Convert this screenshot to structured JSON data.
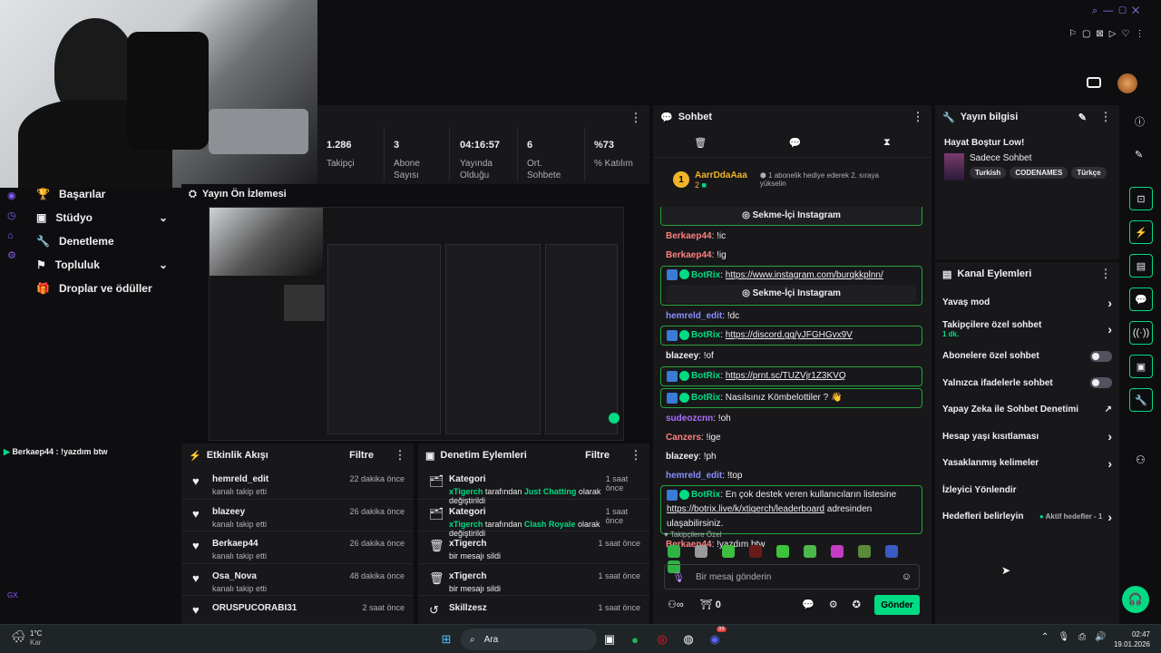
{
  "stats": [
    {
      "value": "1.286",
      "label": "Takipçi"
    },
    {
      "value": "3",
      "label": "Abone Sayısı"
    },
    {
      "value": "04:16:57",
      "label": "Yayında Olduğu"
    },
    {
      "value": "6",
      "label": "Ort. Sohbete"
    },
    {
      "value": "%73",
      "label": "% Katılım"
    }
  ],
  "nav": {
    "items": [
      {
        "label": "Başarılar",
        "chevron": false
      },
      {
        "label": "Stüdyo",
        "chevron": true
      },
      {
        "label": "Denetleme",
        "chevron": false
      },
      {
        "label": "Topluluk",
        "chevron": true
      },
      {
        "label": "Droplar ve ödüller",
        "chevron": false
      }
    ]
  },
  "preview": {
    "title": "Yayın Ön İzlemesi"
  },
  "side_chat_line": "Berkaep44 : !yazdım btw",
  "side_gx": "GX",
  "activity": {
    "title": "Etkinlik Akışı",
    "filter": "Filtre",
    "rows": [
      {
        "name": "hemreld_edit",
        "sub": "kanalı takip etti",
        "time": "22 dakika önce"
      },
      {
        "name": "blazeey",
        "sub": "kanalı takip etti",
        "time": "26 dakika önce"
      },
      {
        "name": "Berkaep44",
        "sub": "kanalı takip etti",
        "time": "26 dakika önce"
      },
      {
        "name": "Osa_Nova",
        "sub": "kanalı takip etti",
        "time": "48 dakika önce"
      },
      {
        "name": "ORUSPUCORABI31",
        "sub": "",
        "time": "2 saat önce"
      }
    ]
  },
  "moderation": {
    "title": "Denetim Eylemleri",
    "filter": "Filtre",
    "rows": [
      {
        "title": "Kategori",
        "actor": "xTigerch",
        "mid": " tarafından ",
        "target": "Just Chatting",
        "end": " olarak değiştirildi",
        "time": "1 saat önce"
      },
      {
        "title": "Kategori",
        "actor": "xTigerch",
        "mid": " tarafından ",
        "target": "Clash Royale",
        "end": " olarak değiştirildi",
        "time": "1 saat önce"
      },
      {
        "title": "xTigerch",
        "actor": "",
        "mid": "bir mesajı sildi",
        "target": "",
        "end": "",
        "time": "1 saat önce"
      },
      {
        "title": "xTigerch",
        "actor": "",
        "mid": "bir mesajı sildi",
        "target": "",
        "end": "",
        "time": "1 saat önce"
      },
      {
        "title": "Skillzesz",
        "actor": "",
        "mid": "",
        "target": "",
        "end": "",
        "time": "1 saat önce"
      }
    ]
  },
  "chat": {
    "title": "Sohbet",
    "gift_user": "AarrDdaAaa",
    "gift_count": "2",
    "gift_rank": "1",
    "gift_text": "1 abonelik hediye ederek 2. sıraya yükselin",
    "instagram_label": "Sekme-İçi Instagram",
    "messages": [
      {
        "user": "Berkaep44",
        "text": "!ic",
        "bot": false,
        "color": "#ff7f7f"
      },
      {
        "user": "Berkaep44",
        "text": "!ig",
        "bot": false,
        "color": "#ff7f7f"
      },
      {
        "user": "BotRix",
        "text": "https://www.instagram.com/burqkkplnn/",
        "bot": true,
        "link": true,
        "ig": true
      },
      {
        "user": "hemreld_edit",
        "text": "!dc",
        "bot": false,
        "color": "#8a8cff"
      },
      {
        "user": "BotRix",
        "text": "https://discord.gg/yJFGHGvx9V",
        "bot": true,
        "link": true
      },
      {
        "user": "blazeey",
        "text": "!of",
        "bot": false,
        "color": "#efeff1"
      },
      {
        "user": "BotRix",
        "text": "https://prnt.sc/TUZVjr1Z3KVQ",
        "bot": true,
        "link": true
      },
      {
        "user": "BotRix",
        "text": "Nasılsınız Kömbelottiler ? 👋",
        "bot": true,
        "link": false
      },
      {
        "user": "sudeozcnn",
        "text": "!oh",
        "bot": false,
        "color": "#a970ff"
      },
      {
        "user": "Canzers",
        "text": "!ige",
        "bot": false,
        "color": "#ff7f7f"
      },
      {
        "user": "blazeey",
        "text": "!ph",
        "bot": false,
        "color": "#efeff1"
      },
      {
        "user": "hemreld_edit",
        "text": "!top",
        "bot": false,
        "color": "#8a8cff"
      }
    ],
    "leaderboard_text": "En çok destek veren kullanıcıların listesine",
    "leaderboard_link": "https://botrix.live/k/xtigerch/leaderboard",
    "leaderboard_end": " adresinden ulaşabilirsiniz.",
    "last_msg_user": "Berkaep44",
    "last_msg_text": "!yazdım btw",
    "emote_section": "Takipçilere Özel",
    "input_placeholder": "Bir mesaj gönderin",
    "points": "0",
    "send_label": "Gönder"
  },
  "stream_info": {
    "title": "Yayın bilgisi",
    "stream_title": "Hayat Boştur Low!",
    "category": "Sadece Sohbet",
    "tags": [
      "Turkish",
      "CODENAMES",
      "Türkçe"
    ]
  },
  "channel_actions": {
    "title": "Kanal Eylemleri",
    "items": [
      {
        "label": "Yavaş mod",
        "control": "chevron",
        "sub": ""
      },
      {
        "label": "Takipçilere özel sohbet",
        "control": "chevron",
        "sub": "1 dk."
      },
      {
        "label": "Abonelere özel sohbet",
        "control": "toggle",
        "sub": ""
      },
      {
        "label": "Yalnızca ifadelerle sohbet",
        "control": "toggle",
        "sub": ""
      },
      {
        "label": "Yapay Zeka ile Sohbet Denetimi",
        "control": "external",
        "sub": ""
      },
      {
        "label": "Hesap yaşı kısıtlaması",
        "control": "chevron",
        "sub": ""
      },
      {
        "label": "Yasaklanmış kelimeler",
        "control": "chevron",
        "sub": ""
      },
      {
        "label": "İzleyici Yönlendir",
        "control": "none",
        "sub": ""
      },
      {
        "label": "Hedefleri belirleyin",
        "control": "chevron",
        "sub": ""
      }
    ],
    "active_goals": "Aktif hedefler - 1"
  },
  "taskbar": {
    "weather_temp": "1°C",
    "weather_text": "Kar",
    "search": "Ara",
    "time": "02:47",
    "date": "19.01.2026",
    "discord_badge": "99"
  },
  "colors": {
    "accent": "#00db84",
    "bg": "#0e0e10",
    "panel": "#18181b"
  }
}
